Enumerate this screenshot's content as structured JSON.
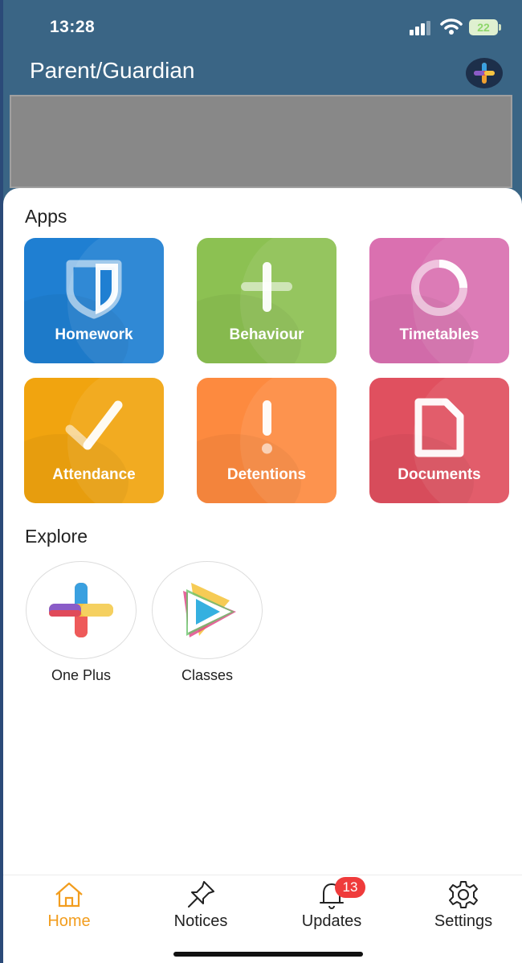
{
  "status_bar": {
    "time": "13:28",
    "battery_level": "22"
  },
  "header": {
    "title": "Parent/Guardian"
  },
  "apps_section": {
    "title": "Apps",
    "tiles": [
      {
        "label": "Homework",
        "color": "#1f7fd2"
      },
      {
        "label": "Behaviour",
        "color": "#8cc152"
      },
      {
        "label": "Timetables",
        "color": "#da70b0"
      },
      {
        "label": "Attendance",
        "color": "#f1a40f"
      },
      {
        "label": "Detentions",
        "color": "#fd8a3f"
      },
      {
        "label": "Documents",
        "color": "#e0505f"
      }
    ]
  },
  "explore_section": {
    "title": "Explore",
    "items": [
      {
        "label": "One Plus"
      },
      {
        "label": "Classes"
      }
    ]
  },
  "tab_bar": {
    "tabs": [
      {
        "label": "Home",
        "icon": "home-icon",
        "active": true
      },
      {
        "label": "Notices",
        "icon": "pin-icon",
        "active": false
      },
      {
        "label": "Updates",
        "icon": "bell-icon",
        "active": false,
        "badge": "13"
      },
      {
        "label": "Settings",
        "icon": "gear-icon",
        "active": false
      }
    ]
  },
  "colors": {
    "accent": "#f29d1e",
    "header_bg": "#3a6585",
    "badge": "#ef3b3b"
  }
}
